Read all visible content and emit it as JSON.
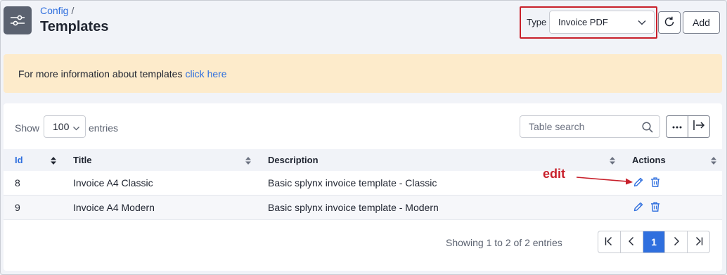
{
  "breadcrumb": {
    "parent": "Config",
    "separator": "/"
  },
  "page_title": "Templates",
  "type_filter": {
    "label": "Type",
    "value": "Invoice PDF"
  },
  "toolbar": {
    "add_label": "Add"
  },
  "info_banner": {
    "text": "For more information about templates",
    "link_text": "click here"
  },
  "table_controls": {
    "show_label": "Show",
    "page_length": "100",
    "entries_label": "entries",
    "search_placeholder": "Table search"
  },
  "table": {
    "columns": [
      "Id",
      "Title",
      "Description",
      "Actions"
    ],
    "rows": [
      {
        "id": "8",
        "title": "Invoice A4 Classic",
        "description": "Basic splynx invoice template - Classic"
      },
      {
        "id": "9",
        "title": "Invoice A4 Modern",
        "description": "Basic splynx invoice template - Modern"
      }
    ]
  },
  "footer": {
    "info": "Showing 1 to 2 of 2 entries",
    "current_page": "1"
  },
  "annotation": {
    "text": "edit"
  },
  "colors": {
    "accent": "#2f6fde",
    "annotation": "#c8202b",
    "banner": "#fdebcb"
  },
  "icons": [
    "sliders-icon",
    "chevron-down-icon",
    "refresh-icon",
    "search-icon",
    "more-icon",
    "export-icon",
    "sort-icon",
    "edit-icon",
    "trash-icon",
    "first-page-icon",
    "prev-page-icon",
    "next-page-icon",
    "last-page-icon"
  ]
}
